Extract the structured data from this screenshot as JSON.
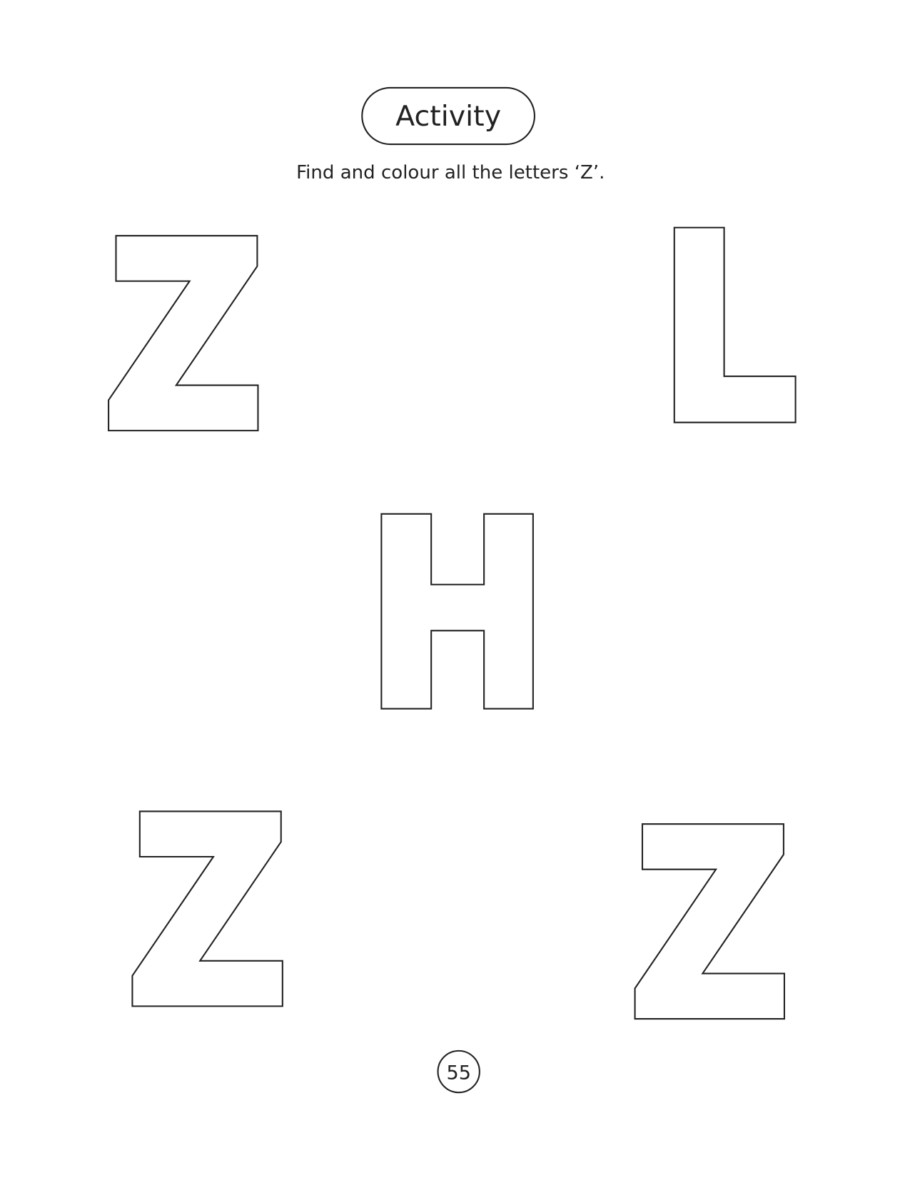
{
  "header": {
    "title": "Activity",
    "instruction": "Find and colour all the letters ‘Z’."
  },
  "letters": [
    "Z",
    "L",
    "H",
    "Z",
    "Z"
  ],
  "page_number": "55"
}
